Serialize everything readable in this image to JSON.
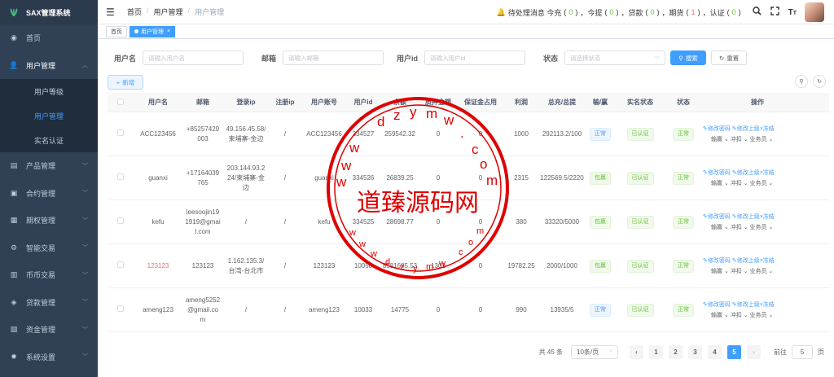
{
  "app": {
    "title": "SAX管理系统"
  },
  "sidebar": {
    "items": [
      {
        "label": "首页",
        "icon": "dashboard-icon"
      },
      {
        "label": "用户管理",
        "icon": "user-icon",
        "open": true,
        "children": [
          {
            "label": "用户等级"
          },
          {
            "label": "用户管理",
            "active": true
          },
          {
            "label": "实名认证"
          }
        ]
      },
      {
        "label": "产品管理",
        "icon": "document-icon"
      },
      {
        "label": "合约管理",
        "icon": "contract-icon"
      },
      {
        "label": "期权管理",
        "icon": "calendar-icon"
      },
      {
        "label": "智能交易",
        "icon": "gear-icon"
      },
      {
        "label": "币币交易",
        "icon": "exchange-icon"
      },
      {
        "label": "贷款管理",
        "icon": "loan-icon"
      },
      {
        "label": "资金管理",
        "icon": "wallet-icon"
      },
      {
        "label": "系统设置",
        "icon": "settings-icon"
      }
    ]
  },
  "header": {
    "breadcrumb": [
      "首页",
      "用户管理",
      "用户管理"
    ],
    "notice": {
      "prefix": "待处理消息 今充",
      "items": [
        {
          "label": "今充",
          "value": "0"
        },
        {
          "label": "今提",
          "value": "0"
        },
        {
          "label": "贷款",
          "value": "0"
        },
        {
          "label": "期货",
          "value": "1"
        }
      ],
      "labels": {
        "tiqu": "今提",
        "daikuan": "贷款",
        "qihuo": "期货",
        "renzheng": "认证"
      },
      "values": {
        "jinchong": "0",
        "jinti": "0",
        "daikuan": "0",
        "qihuo": "1",
        "renzheng": "0"
      }
    }
  },
  "tags": [
    {
      "label": "首页"
    },
    {
      "label": "用户管理",
      "active": true
    }
  ],
  "search": {
    "username_label": "用户名",
    "username_ph": "请输入用户名",
    "email_label": "邮箱",
    "email_ph": "请输入邮箱",
    "userid_label": "用户id",
    "userid_ph": "请输入用户id",
    "status_label": "状态",
    "status_ph": "请选择状态",
    "search_btn": "搜索",
    "reset_btn": "重置",
    "add_btn": "新增"
  },
  "table": {
    "headers": [
      "用户名",
      "邮箱",
      "登录ip",
      "注册ip",
      "用户账号",
      "用户id",
      "余额",
      "质押金额",
      "保证金占用",
      "利润",
      "总充/总提",
      "输/赢",
      "实名状态",
      "状态",
      "操作"
    ],
    "rows": [
      {
        "username": "ACC123456",
        "email": "+85257429003",
        "login_ip": "49.156.45.58/柬埔寨-金边",
        "reg_ip": "/",
        "account": "ACC123456",
        "uid": "334527",
        "balance": "259542.32",
        "pledge": "0",
        "margin": "0",
        "profit": "1000",
        "total": "292113.2/100",
        "winlose": "正常",
        "winlose_color": "blue",
        "realname": "已认证",
        "status": "正常",
        "name_red": false
      },
      {
        "username": "guanxi",
        "email": "+17164039765",
        "login_ip": "203.144.93.224/柬埔寨-金边",
        "reg_ip": "/",
        "account": "guanxi",
        "uid": "334526",
        "balance": "26839.25",
        "pledge": "0",
        "margin": "0",
        "profit": "2315",
        "total": "122569.5/2220",
        "winlose": "包赢",
        "winlose_color": "green",
        "realname": "已认证",
        "status": "正常",
        "name_red": false
      },
      {
        "username": "kefu",
        "email": "leesoojin191919@gmail.com",
        "login_ip": "/",
        "reg_ip": "/",
        "account": "kefu",
        "uid": "334525",
        "balance": "28698.77",
        "pledge": "0",
        "margin": "0",
        "profit": "380",
        "total": "33320/5000",
        "winlose": "包赢",
        "winlose_color": "green",
        "realname": "已认证",
        "status": "正常",
        "name_red": false
      },
      {
        "username": "123123",
        "email": "123123",
        "login_ip": "1.162.135.3/台湾-台北市",
        "reg_ip": "/",
        "account": "123123",
        "uid": "10050",
        "balance": "8581605.53",
        "pledge": "1301",
        "margin": "0",
        "profit": "19782.25",
        "total": "2000/1000",
        "winlose": "包赢",
        "winlose_color": "green",
        "realname": "已认证",
        "status": "正常",
        "name_red": true
      },
      {
        "username": "ameng123",
        "email": "ameng5252@gmail.com",
        "login_ip": "/",
        "reg_ip": "/",
        "account": "ameng123",
        "uid": "10033",
        "balance": "14775",
        "pledge": "0",
        "margin": "0",
        "profit": "990",
        "total": "13935/5",
        "winlose": "正常",
        "winlose_color": "blue",
        "realname": "已认证",
        "status": "正常",
        "name_red": false
      }
    ],
    "ops": {
      "edit_pwd": "修改密码",
      "edit_parent": "修改上级",
      "freeze": "冻结",
      "winlose": "输赢",
      "adjust": "冲扣",
      "salesman": "业务员"
    }
  },
  "pager": {
    "total_text": "共 45 条",
    "page_size": "10条/页",
    "pages": [
      "1",
      "2",
      "3",
      "4",
      "5"
    ],
    "active_page": "5",
    "jump_label": "前往",
    "jump_value": "5",
    "jump_suffix": "页"
  },
  "watermark": {
    "main": "道臻源码网",
    "top": "dzym.com",
    "bottom": "dzym.com"
  },
  "colors": {
    "sidebar": "#304156",
    "accent": "#409eff",
    "success": "#67c23a",
    "danger": "#f56c6c"
  }
}
